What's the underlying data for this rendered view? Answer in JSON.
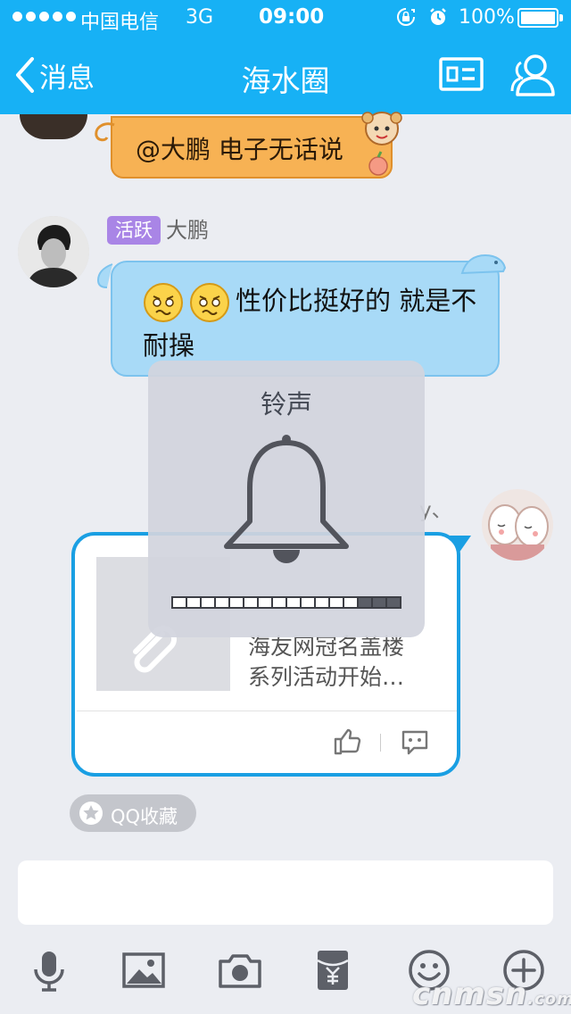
{
  "status_bar": {
    "carrier": "中国电信",
    "network": "3G",
    "time": "09:00",
    "battery": "100%"
  },
  "nav": {
    "back_label": "消息",
    "title": "海水圈"
  },
  "messages": {
    "orange_bubble_text": "@大鹏 电子无话说",
    "blue_message": {
      "badge": "活跃",
      "sender": "大鹏",
      "text": "性价比挺好的 就是不耐操"
    },
    "partial_name_fragment": "y、",
    "share_card": {
      "title_lines": [
        "海友网冠名盖楼",
        "系列活动开始…"
      ]
    },
    "favorite_chip": "QQ收藏"
  },
  "overlay": {
    "title": "铃声",
    "volume_level": 0.8
  },
  "toolbar": {
    "icons": [
      "microphone-icon",
      "image-icon",
      "camera-icon",
      "red-packet-icon",
      "emoji-icon",
      "plus-icon"
    ]
  },
  "watermark": {
    "text": "cnmsn",
    "suffix": ".com"
  },
  "colors": {
    "header": "#17b1f5",
    "bubble_orange": "#f7b254",
    "bubble_blue": "#a8daf7",
    "card_border": "#1a9fe3",
    "badge_purple": "#a985e6"
  }
}
